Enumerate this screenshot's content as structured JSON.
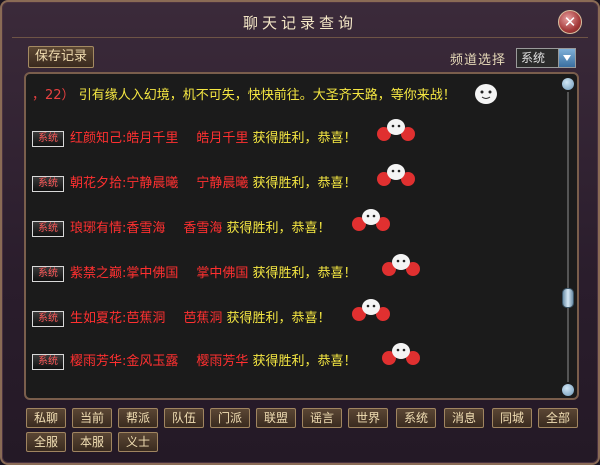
{
  "window": {
    "title": "聊天记录查询",
    "close_label": "✕"
  },
  "toolbar": {
    "save_label": "保存记录",
    "channel_label": "频道选择",
    "channel_value": "系统"
  },
  "messages": {
    "first": {
      "prefix": "，22）",
      "text": "引有缘人入幻境，机不可失，快快前往。大圣齐天路，等你来战！"
    },
    "rows": [
      {
        "tag": "系统",
        "left": "红颜知己:皓月千里",
        "right": "皓月千里",
        "result": "获得胜利，恭喜！"
      },
      {
        "tag": "系统",
        "left": "朝花夕拾:宁静晨曦",
        "right": "宁静晨曦",
        "result": "获得胜利，恭喜！"
      },
      {
        "tag": "系统",
        "left": "琅琊有情:香雪海",
        "right": "香雪海",
        "result": "获得胜利，恭喜！"
      },
      {
        "tag": "系统",
        "left": "紫禁之巅:掌中佛国",
        "right": "掌中佛国",
        "result": "获得胜利，恭喜！"
      },
      {
        "tag": "系统",
        "left": "生如夏花:芭蕉洞",
        "right": "芭蕉洞",
        "result": "获得胜利，恭喜！"
      },
      {
        "tag": "系统",
        "left": "樱雨芳华:金风玉露",
        "right": "樱雨芳华",
        "result": "获得胜利，恭喜！"
      }
    ]
  },
  "channels": {
    "row1": [
      "私聊",
      "当前",
      "帮派",
      "队伍",
      "门派",
      "联盟",
      "谣言",
      "世界",
      "系统",
      "消息",
      "同城",
      "全部"
    ],
    "row2": [
      "全服",
      "本服",
      "义士"
    ]
  },
  "icons": {
    "emote": "cheer-emote-icon",
    "close": "close-icon",
    "dropdown": "chevron-down-icon"
  },
  "colors": {
    "system_text": "#f5e742",
    "name_text": "#ff3030",
    "frame": "#8a6b55"
  }
}
